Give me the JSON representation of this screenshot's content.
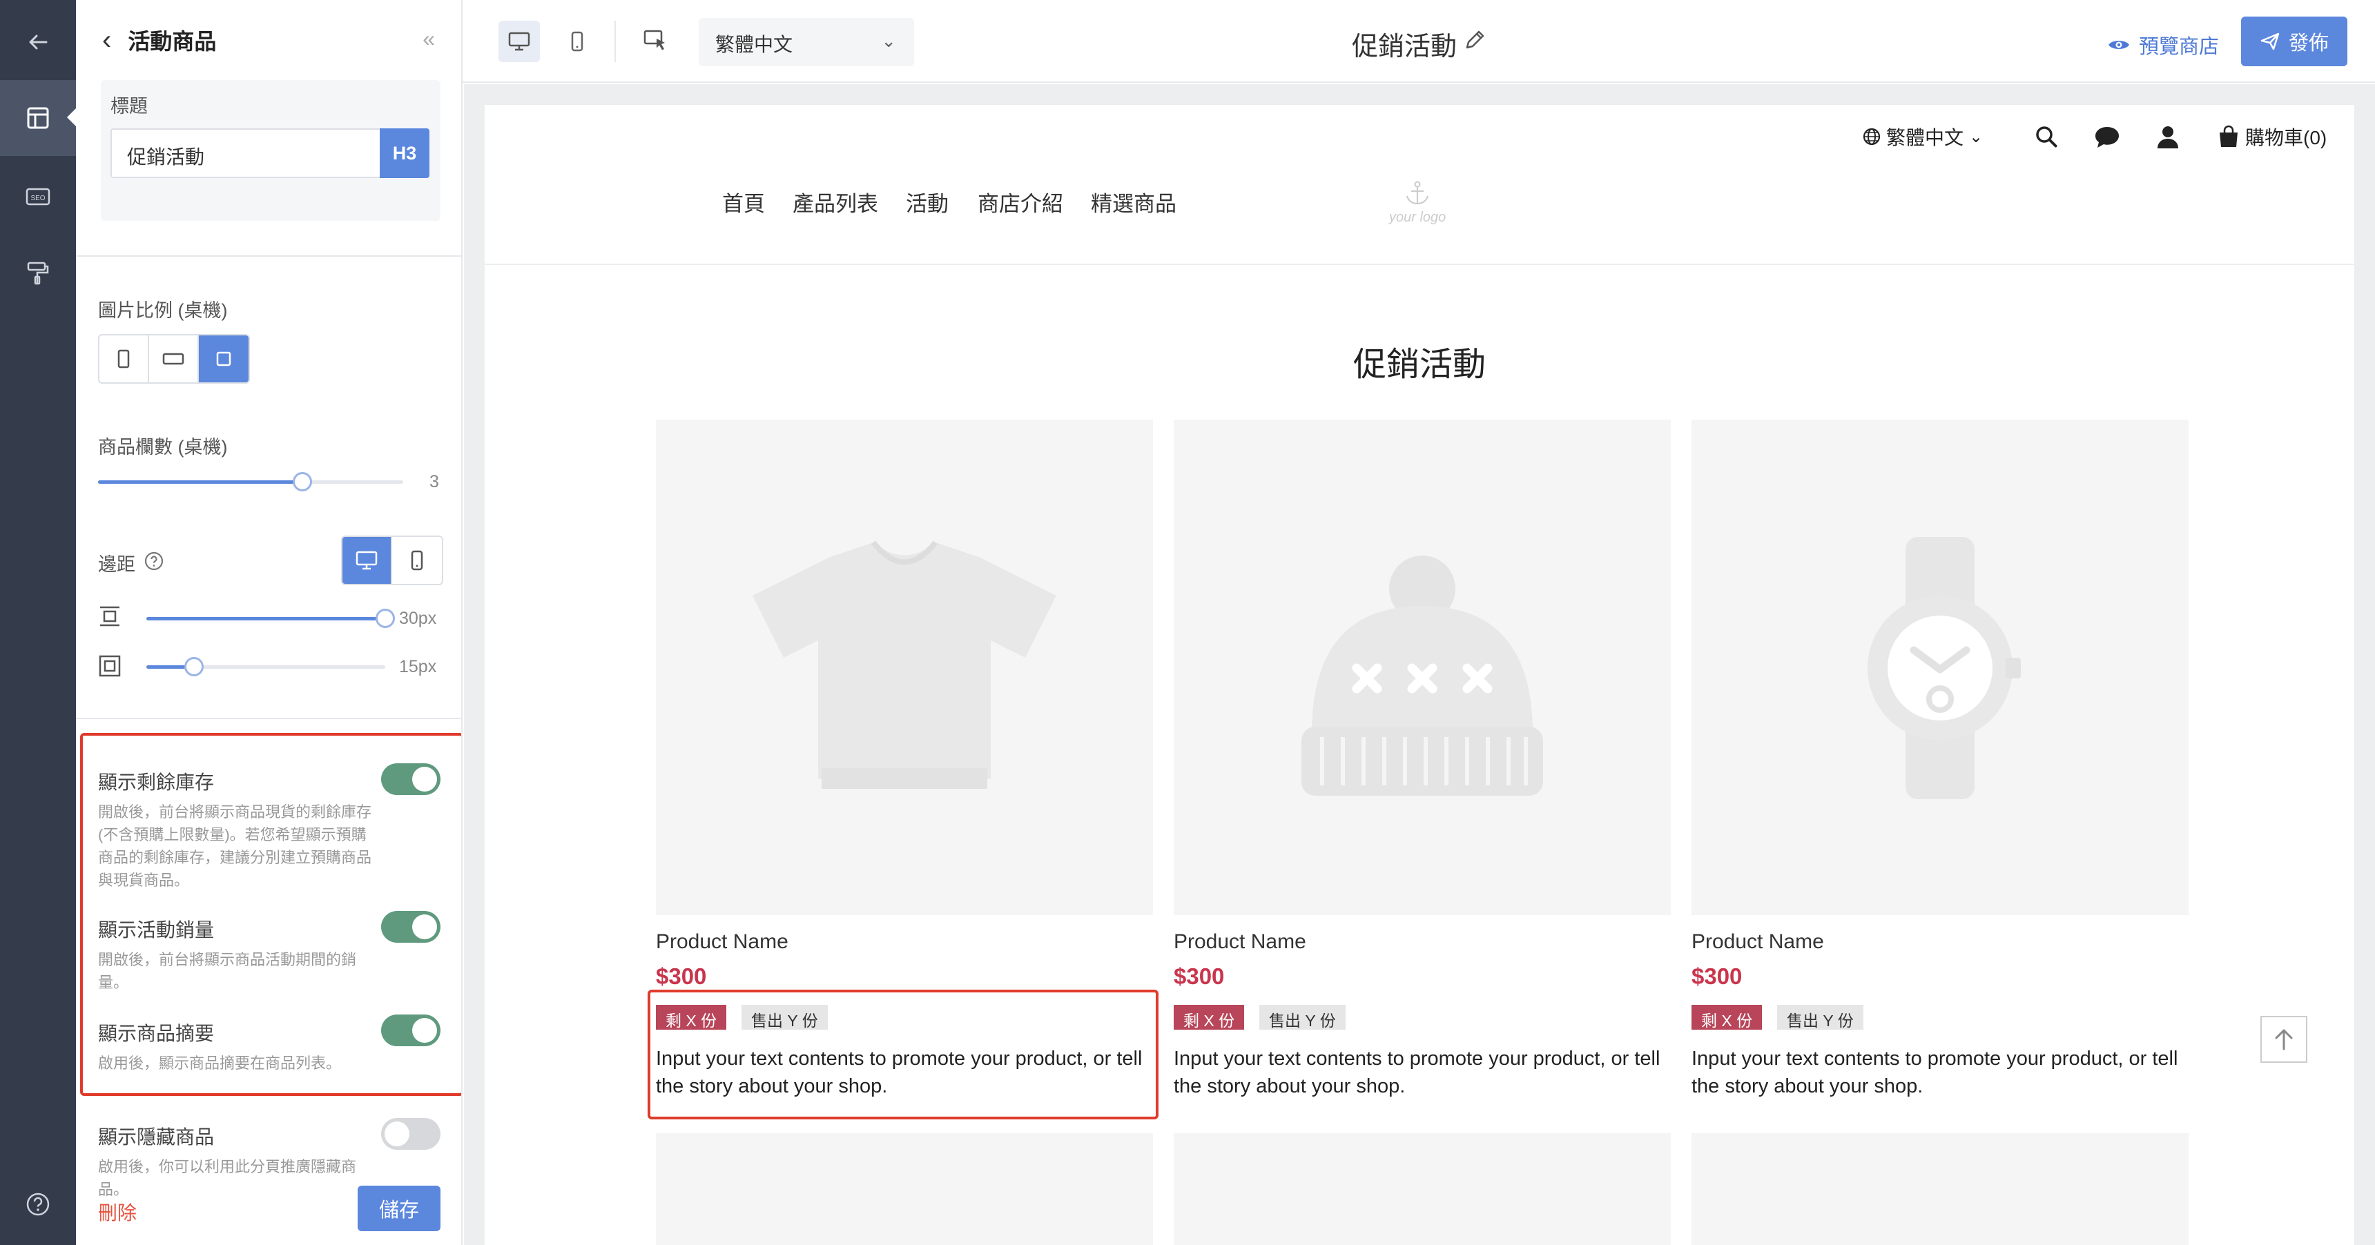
{
  "panel": {
    "title": "活動商品",
    "collapse_glyph": "«",
    "heading_label": "標題",
    "heading_value": "促銷活動",
    "heading_level": "H3",
    "image_ratio_label": "圖片比例 (桌機)",
    "image_ratio_options": [
      "portrait",
      "landscape",
      "square"
    ],
    "image_ratio_selected": "square",
    "columns_label": "商品欄數 (桌機)",
    "columns_value": "3",
    "columns_fraction": 0.67,
    "padding_label": "邊距",
    "padding_device": "desktop",
    "padding_vertical_value": "30px",
    "padding_vertical_fraction": 1.0,
    "padding_inner_value": "15px",
    "padding_inner_fraction": 0.2,
    "toggles": [
      {
        "label": "顯示剩餘庫存",
        "desc": "開啟後，前台將顯示商品現貨的剩餘庫存 (不含預購上限數量)。若您希望顯示預購商品的剩餘庫存，建議分別建立預購商品與現貨商品。",
        "on": true
      },
      {
        "label": "顯示活動銷量",
        "desc": "開啟後，前台將顯示商品活動期間的銷量。",
        "on": true
      },
      {
        "label": "顯示商品摘要",
        "desc": "啟用後，顯示商品摘要在商品列表。",
        "on": true
      },
      {
        "label": "顯示隱藏商品",
        "desc": "啟用後，你可以利用此分頁推廣隱藏商品。",
        "on": false
      }
    ],
    "delete_label": "刪除",
    "save_label": "儲存",
    "highlight_color": "#e03b2b",
    "accent_color": "#5b87dd",
    "toggle_on_color": "#5f9a7e"
  },
  "toolbar": {
    "language": "繁體中文",
    "page_title": "促銷活動",
    "preview_label": "預覽商店",
    "publish_label": "發佈"
  },
  "store": {
    "language": "繁體中文",
    "cart_label": "購物車(0)",
    "nav": [
      "首頁",
      "產品列表",
      "活動",
      "商店介紹",
      "精選商品"
    ],
    "logo_text": "your logo",
    "section_title": "促銷活動",
    "products": [
      {
        "image": "t-shirt-placeholder",
        "name": "Product Name",
        "price": "$300",
        "stock_tag": "剩 X 份",
        "sold_tag": "售出 Y 份",
        "desc": "Input your text contents to promote your product, or tell the story about your shop."
      },
      {
        "image": "beanie-placeholder",
        "name": "Product Name",
        "price": "$300",
        "stock_tag": "剩 X 份",
        "sold_tag": "售出 Y 份",
        "desc": "Input your text contents to promote your product, or tell the story about your shop."
      },
      {
        "image": "watch-placeholder",
        "name": "Product Name",
        "price": "$300",
        "stock_tag": "剩 X 份",
        "sold_tag": "售出 Y 份",
        "desc": "Input your text contents to promote your product, or tell the story about your shop."
      }
    ],
    "price_color": "#c9354d",
    "stock_tag_color": "#b84559"
  }
}
